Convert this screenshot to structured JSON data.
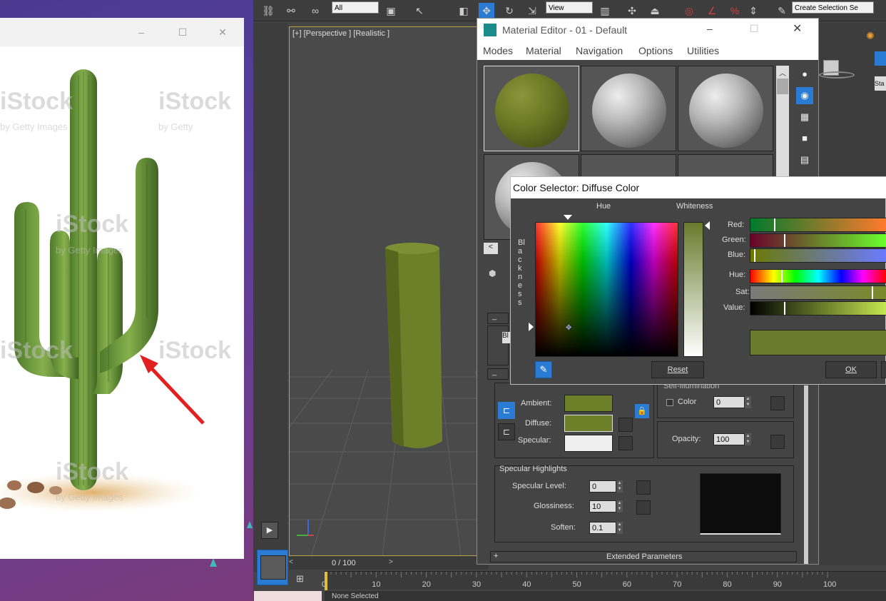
{
  "viewer": {
    "watermark": "iStock",
    "watermark_sub": "by Getty Images",
    "watermark_sub_short": "by Getty"
  },
  "toolbar": {
    "filter_select": "All",
    "view_select": "View",
    "selection_set": "Create Selection Se"
  },
  "viewport": {
    "label": "[+] [Perspective ] [Realistic ]"
  },
  "timeline": {
    "frame": "0 / 100",
    "ticks": [
      "0",
      "10",
      "20",
      "30",
      "40",
      "50",
      "60",
      "70",
      "80",
      "90",
      "100"
    ]
  },
  "status": {
    "selection": "None Selected"
  },
  "material_editor": {
    "title": "Material Editor - 01 - Default",
    "menu": [
      "Modes",
      "Material",
      "Navigation",
      "Options",
      "Utilities"
    ],
    "basic": {
      "ambient_label": "Ambient:",
      "diffuse_label": "Diffuse:",
      "specular_label": "Specular:",
      "ambient_color": "#6e7f2a",
      "diffuse_color": "#6e7f2a",
      "specular_color": "#efefef"
    },
    "self_illum": {
      "title": "Self-Illumination",
      "color_label": "Color",
      "value": "0"
    },
    "opacity": {
      "label": "Opacity:",
      "value": "100"
    },
    "specular_highlights": {
      "title": "Specular Highlights",
      "level_label": "Specular Level:",
      "level_value": "0",
      "gloss_label": "Glossiness:",
      "gloss_value": "10",
      "soften_label": "Soften:",
      "soften_value": "0.1"
    },
    "extended": "Extended Parameters",
    "bl_button": "Bl"
  },
  "color_selector": {
    "title": "Color Selector: Diffuse Color",
    "hue_label": "Hue",
    "whiteness_label": "Whiteness",
    "blackness_label": "Blackness",
    "red_label": "Red:",
    "green_label": "Green:",
    "blue_label": "Blue:",
    "hue_slider_label": "Hue:",
    "sat_label": "Sat:",
    "value_label": "Value:",
    "reset_button": "Reset",
    "ok_button": "OK",
    "current_color": "#6a7a2c"
  },
  "colors": {
    "accent_blue": "#2a7bd4",
    "viewport_border": "#b8a13a",
    "cylinder": "#6e7f2a"
  }
}
